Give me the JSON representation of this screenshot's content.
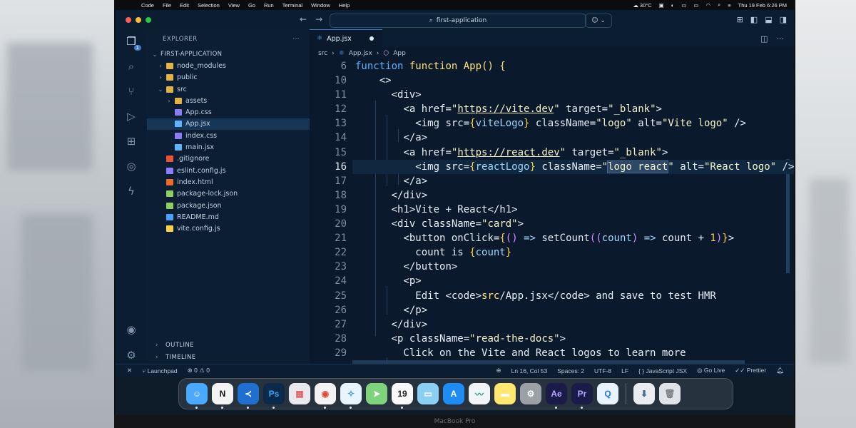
{
  "menubar": {
    "items": [
      "Code",
      "File",
      "Edit",
      "Selection",
      "View",
      "Go",
      "Run",
      "Terminal",
      "Window",
      "Help"
    ],
    "weather": "30°C",
    "datetime": "Thu 19 Feb  6:26 PM"
  },
  "titlebar": {
    "search_text": "first-application"
  },
  "sidebar": {
    "title": "EXPLORER",
    "project": "FIRST-APPLICATION",
    "tree": [
      {
        "label": "node_modules",
        "type": "folder",
        "depth": 1,
        "expanded": false
      },
      {
        "label": "public",
        "type": "folder",
        "depth": 1,
        "expanded": false
      },
      {
        "label": "src",
        "type": "folder",
        "depth": 1,
        "expanded": true
      },
      {
        "label": "assets",
        "type": "folder",
        "depth": 2,
        "expanded": false
      },
      {
        "label": "App.css",
        "type": "css",
        "depth": 2
      },
      {
        "label": "App.jsx",
        "type": "jsx",
        "depth": 2,
        "selected": true
      },
      {
        "label": "index.css",
        "type": "css",
        "depth": 2
      },
      {
        "label": "main.jsx",
        "type": "jsx",
        "depth": 2
      },
      {
        "label": ".gitignore",
        "type": "git",
        "depth": 1
      },
      {
        "label": "eslint.config.js",
        "type": "eslint",
        "depth": 1
      },
      {
        "label": "index.html",
        "type": "html",
        "depth": 1
      },
      {
        "label": "package-lock.json",
        "type": "json",
        "depth": 1
      },
      {
        "label": "package.json",
        "type": "json",
        "depth": 1
      },
      {
        "label": "README.md",
        "type": "info",
        "depth": 1
      },
      {
        "label": "vite.config.js",
        "type": "vite",
        "depth": 1
      }
    ],
    "outline": "OUTLINE",
    "timeline": "TIMELINE",
    "badge": "1"
  },
  "editor": {
    "tab": "App.jsx",
    "breadcrumbs": [
      "src",
      "App.jsx",
      "App"
    ],
    "sticky_line_no": "6",
    "sticky_code": "function App() {",
    "current_line": 16,
    "lines": [
      {
        "n": "10",
        "t": "    <>"
      },
      {
        "n": "11",
        "t": "      <div>"
      },
      {
        "n": "12",
        "t": "        <a href=\"https://vite.dev\" target=\"_blank\">"
      },
      {
        "n": "13",
        "t": "          <img src={viteLogo} className=\"logo\" alt=\"Vite logo\" />"
      },
      {
        "n": "14",
        "t": "        </a>"
      },
      {
        "n": "15",
        "t": "        <a href=\"https://react.dev\" target=\"_blank\">"
      },
      {
        "n": "16",
        "t": "          <img src={reactLogo} className=\"logo react\" alt=\"React logo\" />"
      },
      {
        "n": "17",
        "t": "        </a>"
      },
      {
        "n": "18",
        "t": "      </div>"
      },
      {
        "n": "19",
        "t": "      <h1>Vite + React</h1>"
      },
      {
        "n": "20",
        "t": "      <div className=\"card\">"
      },
      {
        "n": "21",
        "t": "        <button onClick={() => setCount((count) => count + 1)}>"
      },
      {
        "n": "22",
        "t": "          count is {count}"
      },
      {
        "n": "23",
        "t": "        </button>"
      },
      {
        "n": "24",
        "t": "        <p>"
      },
      {
        "n": "25",
        "t": "          Edit <code>src/App.jsx</code> and save to test HMR"
      },
      {
        "n": "26",
        "t": "        </p>"
      },
      {
        "n": "27",
        "t": "      </div>"
      },
      {
        "n": "28",
        "t": "      <p className=\"read-the-docs\">"
      },
      {
        "n": "29",
        "t": "        Click on the Vite and React logos to learn more"
      }
    ]
  },
  "statusbar": {
    "remote": "Launchpad",
    "errors": "0",
    "warnings": "0",
    "position": "Ln 16, Col 53",
    "spaces": "Spaces: 2",
    "encoding": "UTF-8",
    "eol": "LF",
    "language": "JavaScript JSX",
    "golive": "Go Live",
    "prettier": "Prettier"
  },
  "dock": {
    "apps": [
      {
        "name": "finder",
        "glyph": "☺",
        "bg": "#4aa8ff",
        "fg": "#ffffff"
      },
      {
        "name": "notion",
        "glyph": "N",
        "bg": "#f4f4f4",
        "fg": "#111111"
      },
      {
        "name": "vscode",
        "glyph": "≺",
        "bg": "#1f6fd1",
        "fg": "#ffffff"
      },
      {
        "name": "photoshop",
        "glyph": "Ps",
        "bg": "#0b2a4a",
        "fg": "#39a6ff"
      },
      {
        "name": "launchpad",
        "glyph": "▦",
        "bg": "#e8e8ee",
        "fg": "#d66"
      },
      {
        "name": "chrome",
        "glyph": "◉",
        "bg": "#f3f3f3",
        "fg": "#e04a3a"
      },
      {
        "name": "safari",
        "glyph": "✧",
        "bg": "#e8f4ff",
        "fg": "#2a8ff0"
      },
      {
        "name": "maps",
        "glyph": "➤",
        "bg": "#7fd37a",
        "fg": "#ffffff"
      },
      {
        "name": "calendar",
        "glyph": "19",
        "bg": "#fafafa",
        "fg": "#222222"
      },
      {
        "name": "messages",
        "glyph": "▭",
        "bg": "#8ccff5",
        "fg": "#ffffff"
      },
      {
        "name": "appstore",
        "glyph": "A",
        "bg": "#1e8cf5",
        "fg": "#ffffff"
      },
      {
        "name": "freeform",
        "glyph": "〰",
        "bg": "#f1f5f8",
        "fg": "#2a9d8f"
      },
      {
        "name": "notes",
        "glyph": "▬",
        "bg": "#ffe770",
        "fg": "#ffffff"
      },
      {
        "name": "settings",
        "glyph": "⚙",
        "bg": "#9aa0a6",
        "fg": "#ffffff"
      },
      {
        "name": "aftereffects",
        "glyph": "Ae",
        "bg": "#1b1b4a",
        "fg": "#b9a7ff"
      },
      {
        "name": "premiere",
        "glyph": "Pr",
        "bg": "#1b1b4a",
        "fg": "#b9a7ff"
      },
      {
        "name": "quicktime",
        "glyph": "Q",
        "bg": "#e8f3ff",
        "fg": "#1f7ad8"
      }
    ],
    "extras": [
      {
        "name": "downloads",
        "glyph": "⬇",
        "bg": "#e9edf1",
        "fg": "#4b6b8a"
      },
      {
        "name": "trash",
        "glyph": "🗑",
        "bg": "#dfe3e7",
        "fg": "#7a7f85"
      }
    ]
  },
  "laptop_label": "MacBook Pro",
  "colors": {
    "editor_bg": "#0a1a2c",
    "sidebar_bg": "#0c1e33",
    "accent": "#3d7bd1"
  }
}
